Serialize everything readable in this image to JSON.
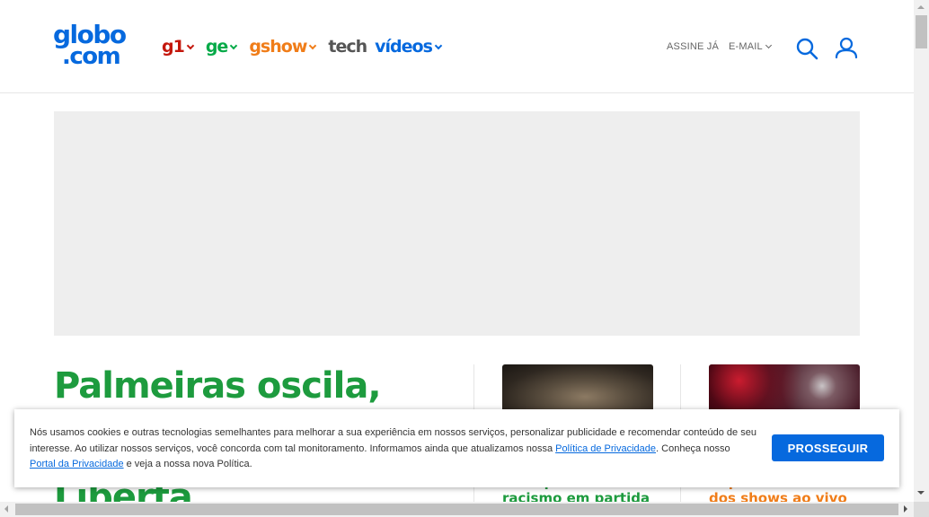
{
  "colors": {
    "brand_blue": "#0669de",
    "g1_red": "#c4170c",
    "ge_green": "#06aa48",
    "gshow_orange": "#f07d19",
    "tech_gray": "#555555",
    "headline_green": "#1d9b3e",
    "ad_gray": "#eeeeee"
  },
  "header": {
    "logo": {
      "line1": "globo",
      "line2": ".com"
    },
    "nav": [
      {
        "label": "g1",
        "has_dropdown": true
      },
      {
        "label": "ge",
        "has_dropdown": true
      },
      {
        "label": "gshow",
        "has_dropdown": true
      },
      {
        "label": "tech",
        "has_dropdown": false
      },
      {
        "label": "vídeos",
        "has_dropdown": true
      }
    ],
    "assine": "ASSINE JÁ",
    "email": "E-MAIL",
    "search_icon": "search-icon",
    "user_icon": "user-icon"
  },
  "main": {
    "headline_line1": "Palmeiras oscila, mas",
    "headline_line_partial": "Liberta",
    "card1": {
      "title_partial": "Wal após caso de racismo em partida"
    },
    "card2": {
      "title_partial": "Repercute a estrela dos shows ao vivo"
    }
  },
  "cookie": {
    "text_before_link1": "Nós usamos cookies e outras tecnologias semelhantes para melhorar a sua experiência em nossos serviços, personalizar publicidade e recomendar conteúdo de seu interesse. Ao utilizar nossos serviços, você concorda com tal monitoramento. Informamos ainda que atualizamos nossa ",
    "link1": "Política de Privacidade",
    "text_between": ". Conheça nosso ",
    "link2": "Portal da Privacidade",
    "text_after": " e veja a nossa nova Política.",
    "button": "PROSSEGUIR"
  }
}
